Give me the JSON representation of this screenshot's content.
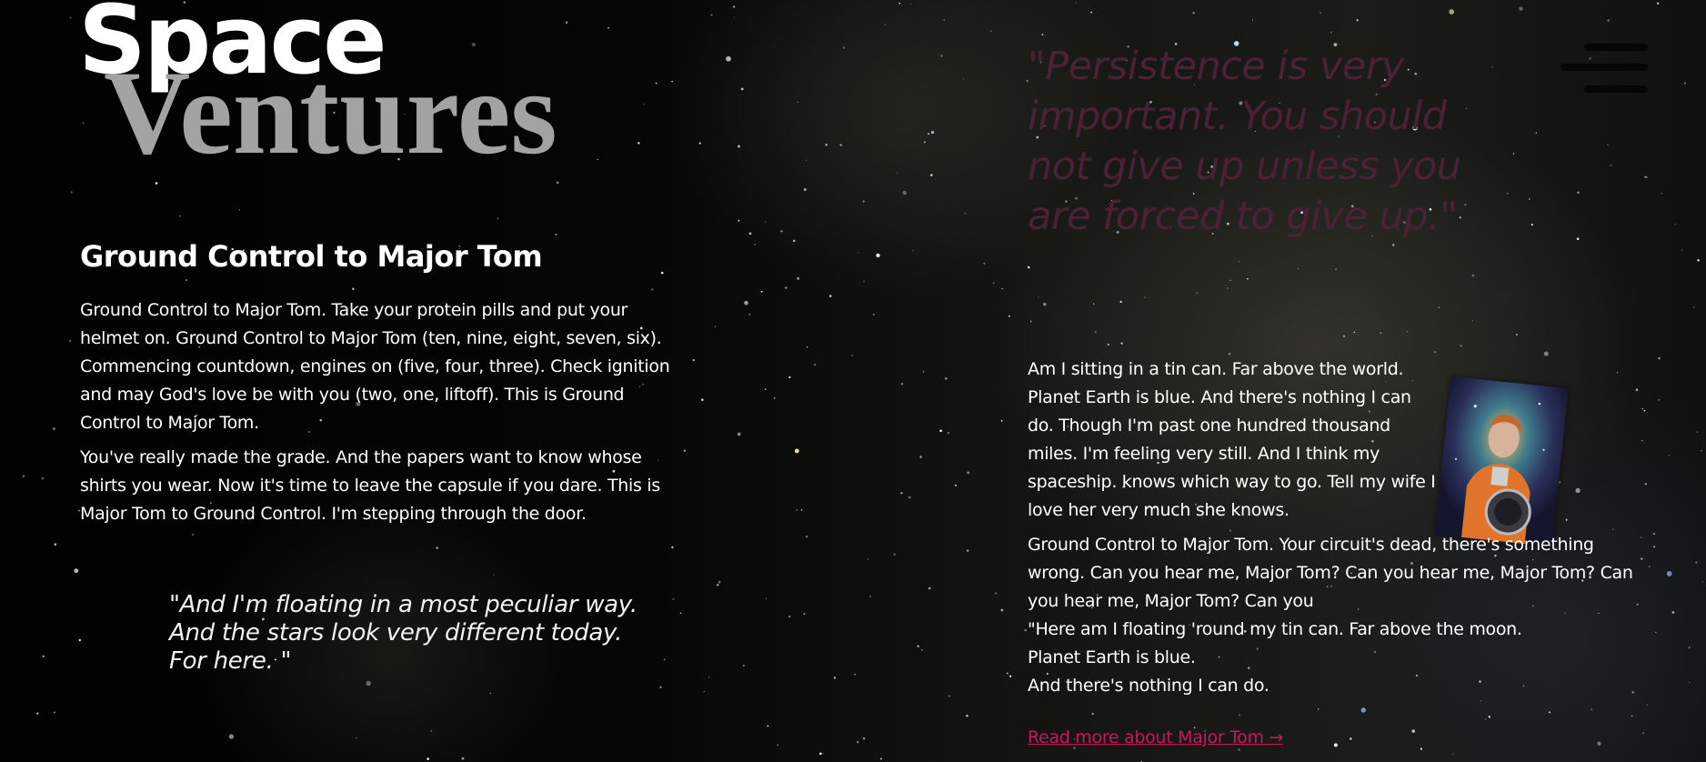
{
  "brand": {
    "line1": "Space",
    "line2": "Ventures"
  },
  "menu": {
    "icon": "hamburger-menu-icon"
  },
  "left": {
    "heading": "Ground Control to Major Tom",
    "paragraph1": "Ground Control to Major Tom. Take your protein pills and put your helmet on. Ground Control to Major Tom (ten, nine, eight, seven, six). Commencing countdown, engines on (five, four, three). Check ignition and may God's love be with you (two, one, liftoff). This is Ground Control to Major Tom.",
    "paragraph2": "You've really made the grade. And the papers want to know whose shirts you wear. Now it's time to leave the capsule if you dare. This is Major Tom to Ground Control. I'm stepping through the door.",
    "quote": "\"And I'm floating in a most peculiar way.\nAnd the stars look very different today.\nFor here. \""
  },
  "right": {
    "quote": "\"Persistence is very important. You should not give up unless you are forced to give up.\"",
    "paragraph1": "Am I sitting in a tin can. Far above the world. Planet Earth is blue. And there's nothing I can do. Though I'm past one hundred thousand miles. I'm feeling very still. And I think my spaceship. knows which way to go. Tell my wife I love her very much she knows.",
    "paragraph2_line1": "Ground Control to Major Tom. Your circuit's dead, there's something wrong. Can you hear me, Major Tom? Can you hear me, Major Tom? Can you hear me, Major Tom? Can you",
    "paragraph2_line2": "\"Here am I floating 'round my tin can. Far above the moon.",
    "paragraph2_line3": "Planet Earth is blue.",
    "paragraph2_line4": "And there's nothing I can do.",
    "photo_icon": "astronaut-portrait-image",
    "read_more": "Read more about Major Tom →"
  },
  "colors": {
    "background": "#050505",
    "logo_ventures": "#a3a3a3",
    "quote_right": "#4a2136",
    "link": "#c8175d"
  }
}
